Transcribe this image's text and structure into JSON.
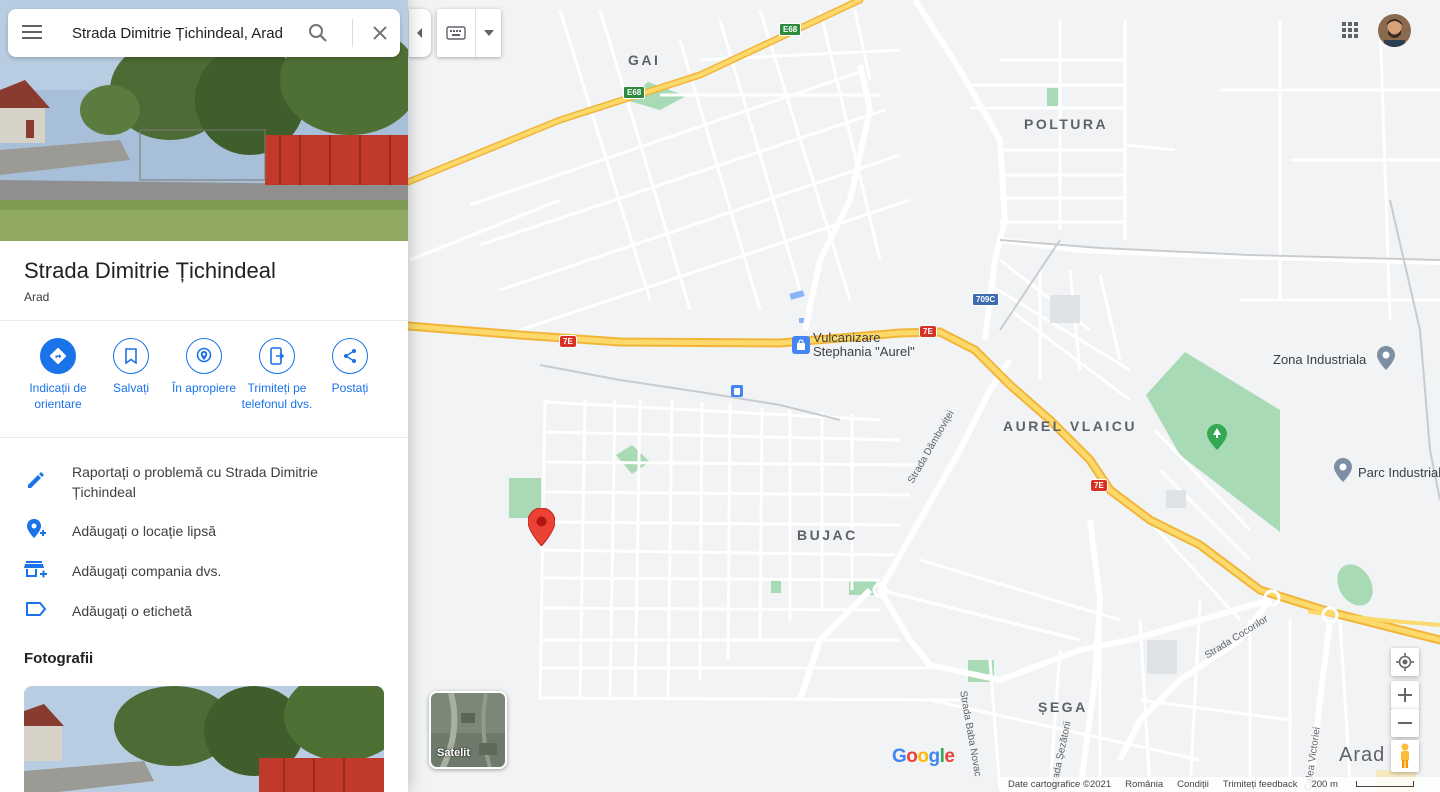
{
  "search": {
    "value": "Strada Dimitrie Țichindeal, Arad"
  },
  "place": {
    "title": "Strada Dimitrie Țichindeal",
    "subtitle": "Arad"
  },
  "actions": [
    {
      "label": "Indicații de orientare",
      "icon": "directions-icon"
    },
    {
      "label": "Salvați",
      "icon": "bookmark-icon"
    },
    {
      "label": "În apropiere",
      "icon": "nearby-icon"
    },
    {
      "label": "Trimiteți pe telefonul dvs.",
      "icon": "send-to-phone-icon"
    },
    {
      "label": "Postați",
      "icon": "share-icon"
    }
  ],
  "rows": [
    {
      "label": "Raportați o problemă cu Strada Dimitrie Țichindeal",
      "icon": "edit-pencil-icon"
    },
    {
      "label": "Adăugați o locație lipsă",
      "icon": "add-location-icon"
    },
    {
      "label": "Adăugați compania dvs.",
      "icon": "add-business-icon"
    },
    {
      "label": "Adăugați o etichetă",
      "icon": "label-icon"
    }
  ],
  "photos": {
    "title": "Fotografii"
  },
  "map": {
    "areas": [
      "GAI",
      "POLTURA",
      "AUREL VLAICU",
      "BUJAC",
      "ȘEGA",
      "Arad"
    ],
    "pois": [
      "Vulcanizare Stephania \"Aurel\"",
      "Zona Industriala",
      "Parc Industrial"
    ],
    "streets": [
      "Strada Dâmboviței",
      "Strada Cocorilor",
      "Strada Baba Novac",
      "Strada Șezătorii",
      "Calea Victoriei"
    ],
    "shields": [
      "E68",
      "E68",
      "7E",
      "7E",
      "7E",
      "709C"
    ],
    "satellite_label": "Satelit",
    "logo": "Google",
    "footer": {
      "data": "Date cartografice ©2021",
      "country": "România",
      "terms": "Condiții",
      "feedback": "Trimiteți feedback",
      "scale": "200 m"
    }
  },
  "colors": {
    "accent": "#1a73e8",
    "highway": "#f9c84a",
    "park": "#a8dab5",
    "pin": "#ea4335"
  }
}
